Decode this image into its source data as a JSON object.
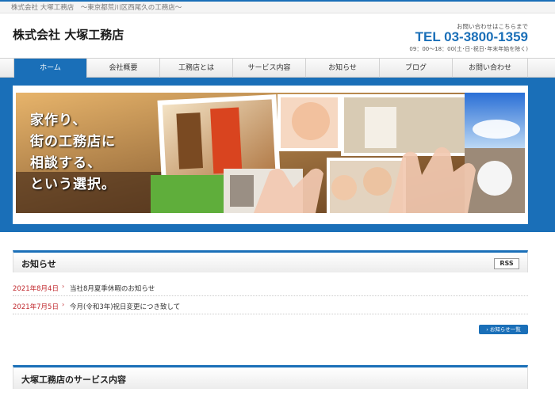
{
  "topbar": {
    "tagline": "株式会社 大塚工務店　～東京都荒川区西尾久の工務店～"
  },
  "header": {
    "title": "株式会社 大塚工務店",
    "contact_label": "お問い合わせはこちらまで",
    "tel": "TEL 03-3800-1359",
    "hours": "09：00～18：00(土･日･祝日･年末年始を除く)"
  },
  "nav": {
    "items": [
      {
        "label": "ホーム",
        "active": true
      },
      {
        "label": "会社概要"
      },
      {
        "label": "工務店とは"
      },
      {
        "label": "サービス内容"
      },
      {
        "label": "お知らせ"
      },
      {
        "label": "ブログ"
      },
      {
        "label": "お問い合わせ"
      }
    ]
  },
  "hero": {
    "lines": [
      "家作り、",
      "街の工務店に",
      "相談する、",
      "という選択。"
    ]
  },
  "news": {
    "title": "お知らせ",
    "rss_label": "RSS",
    "items": [
      {
        "date": "2021年8月4日",
        "arrow": "›",
        "text": "当社8月夏季休暇のお知らせ"
      },
      {
        "date": "2021年7月5日",
        "arrow": "›",
        "text": "今月(令和3年)祝日変更につき致して"
      }
    ],
    "more_label": "› お知らせ一覧"
  },
  "services": {
    "title": "大塚工務店のサービス内容"
  },
  "colors": {
    "brand": "#1a6fb8",
    "date_red": "#c0282d"
  }
}
